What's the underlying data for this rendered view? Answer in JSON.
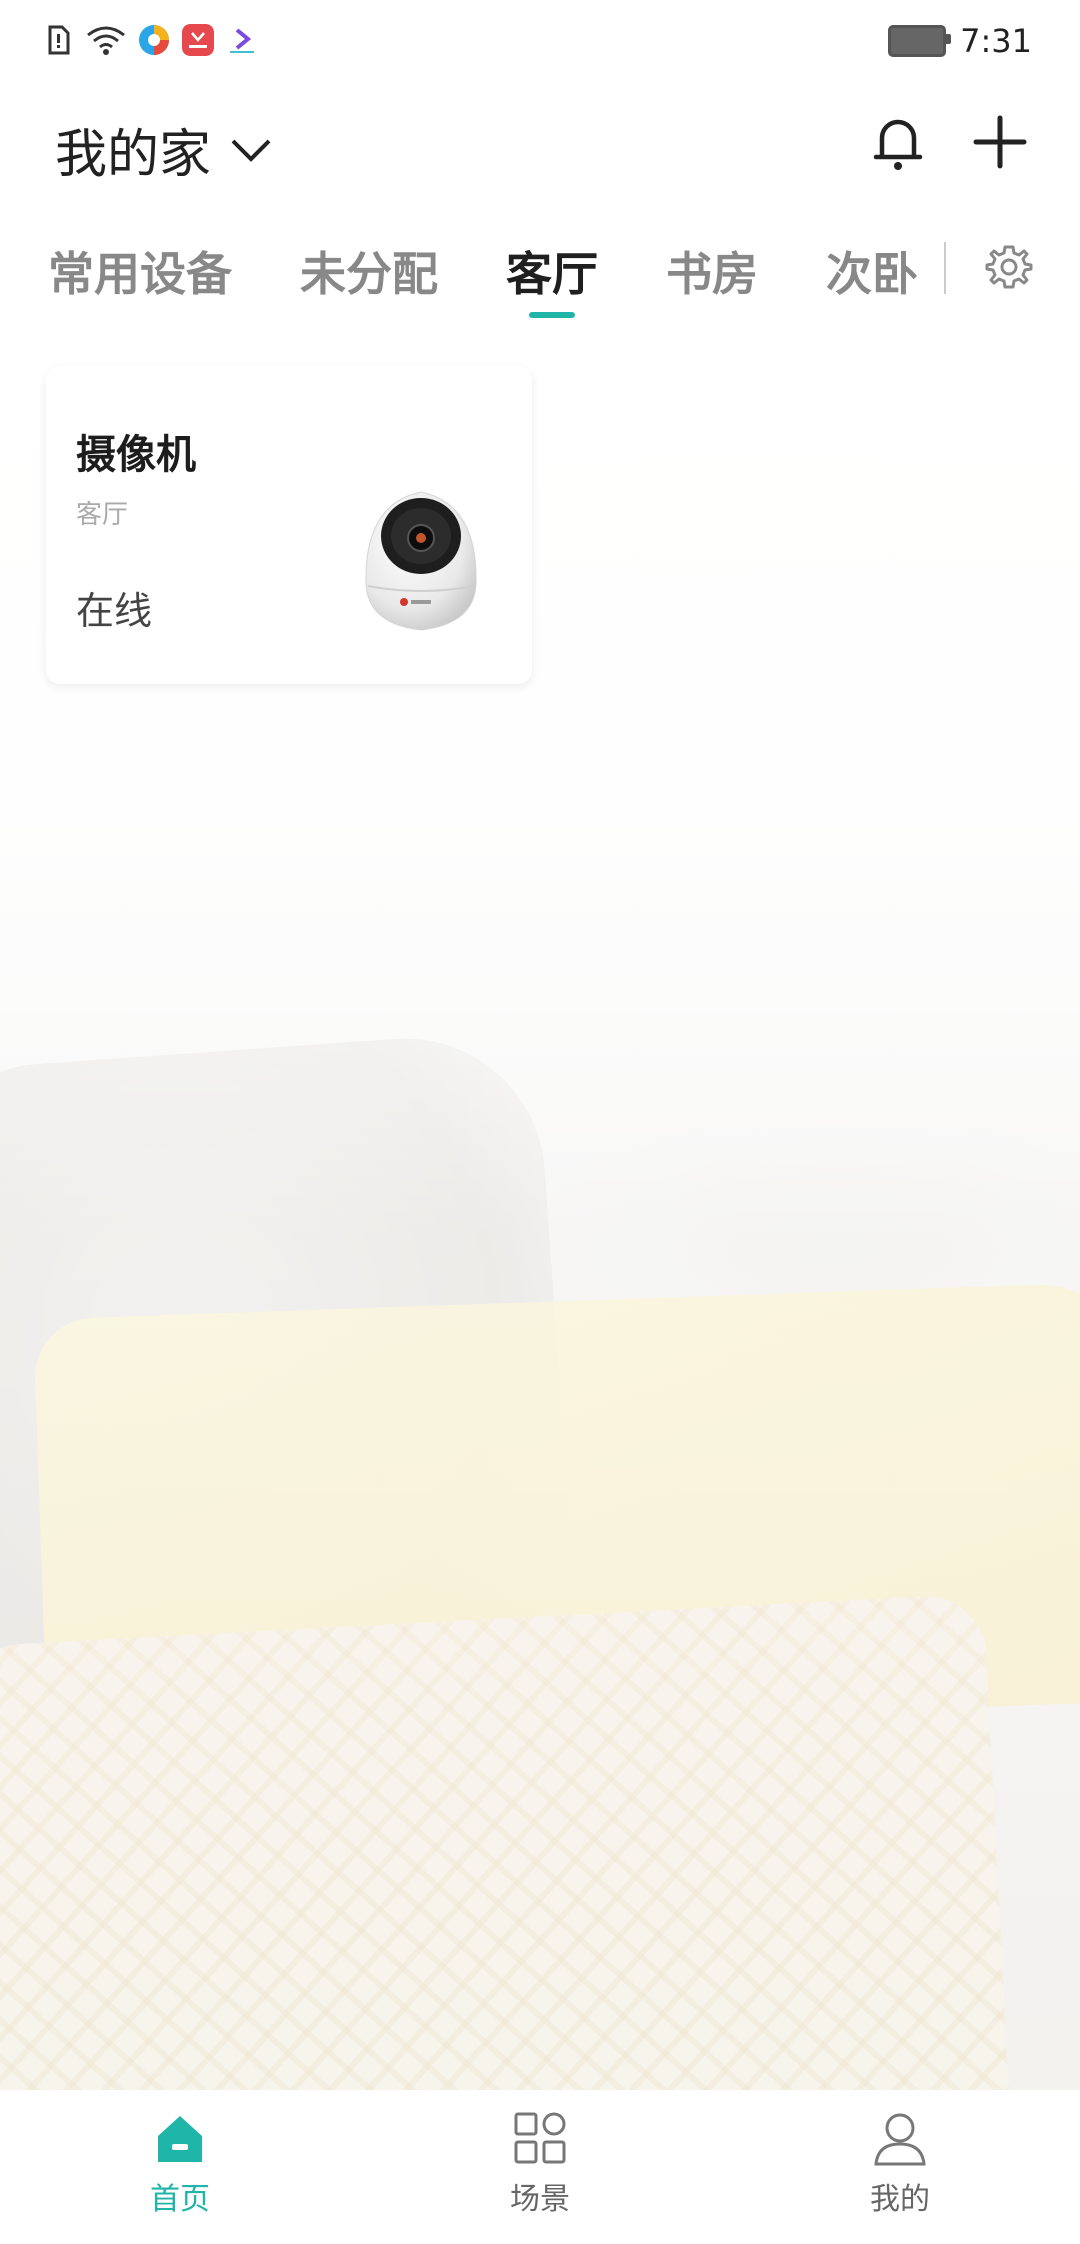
{
  "status_bar": {
    "time": "7:31",
    "icons": [
      "sim-alert-icon",
      "wifi-icon",
      "browser-app-icon",
      "huawei-app-icon",
      "video-app-icon",
      "battery-charging-icon"
    ]
  },
  "header": {
    "home_name": "我的家",
    "actions": [
      "bell-icon",
      "plus-icon"
    ]
  },
  "tabs": {
    "items": [
      {
        "label": "常用设备",
        "active": false
      },
      {
        "label": "未分配",
        "active": false
      },
      {
        "label": "客厅",
        "active": true
      },
      {
        "label": "书房",
        "active": false
      },
      {
        "label": "次卧",
        "active": false
      }
    ],
    "accent_color": "#1fb5a8"
  },
  "devices": [
    {
      "name": "摄像机",
      "room": "客厅",
      "status": "在线",
      "icon": "camera-icon"
    }
  ],
  "bottom_nav": {
    "items": [
      {
        "label": "首页",
        "icon": "home-icon",
        "active": true
      },
      {
        "label": "场景",
        "icon": "scenes-icon",
        "active": false
      },
      {
        "label": "我的",
        "icon": "profile-icon",
        "active": false
      }
    ]
  }
}
